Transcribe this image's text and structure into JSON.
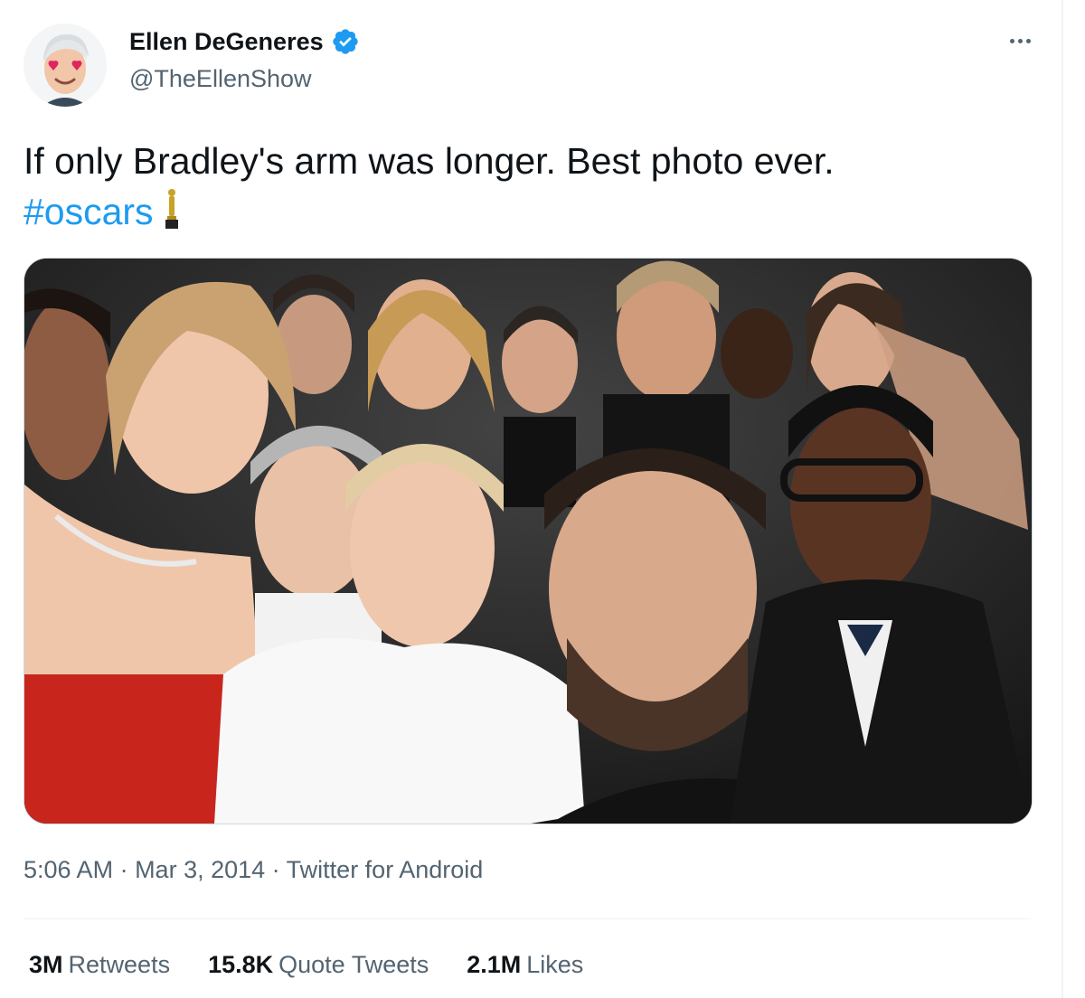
{
  "author": {
    "display_name": "Ellen DeGeneres",
    "handle": "@TheEllenShow",
    "verified": true
  },
  "more_icon": "more-horizontal-icon",
  "tweet": {
    "text": "If only Bradley's arm was longer. Best photo ever. ",
    "hashtag": "#oscars",
    "emoji_icon": "oscar-trophy-icon"
  },
  "meta": {
    "time": "5:06 AM",
    "separator": " · ",
    "date": "Mar 3, 2014",
    "source": "Twitter for Android"
  },
  "stats": [
    {
      "value": "3M",
      "label": "Retweets"
    },
    {
      "value": "15.8K",
      "label": "Quote Tweets"
    },
    {
      "value": "2.1M",
      "label": "Likes"
    }
  ],
  "colors": {
    "accent": "#1d9bf0",
    "text": "#0f1419",
    "secondary": "#536471"
  }
}
